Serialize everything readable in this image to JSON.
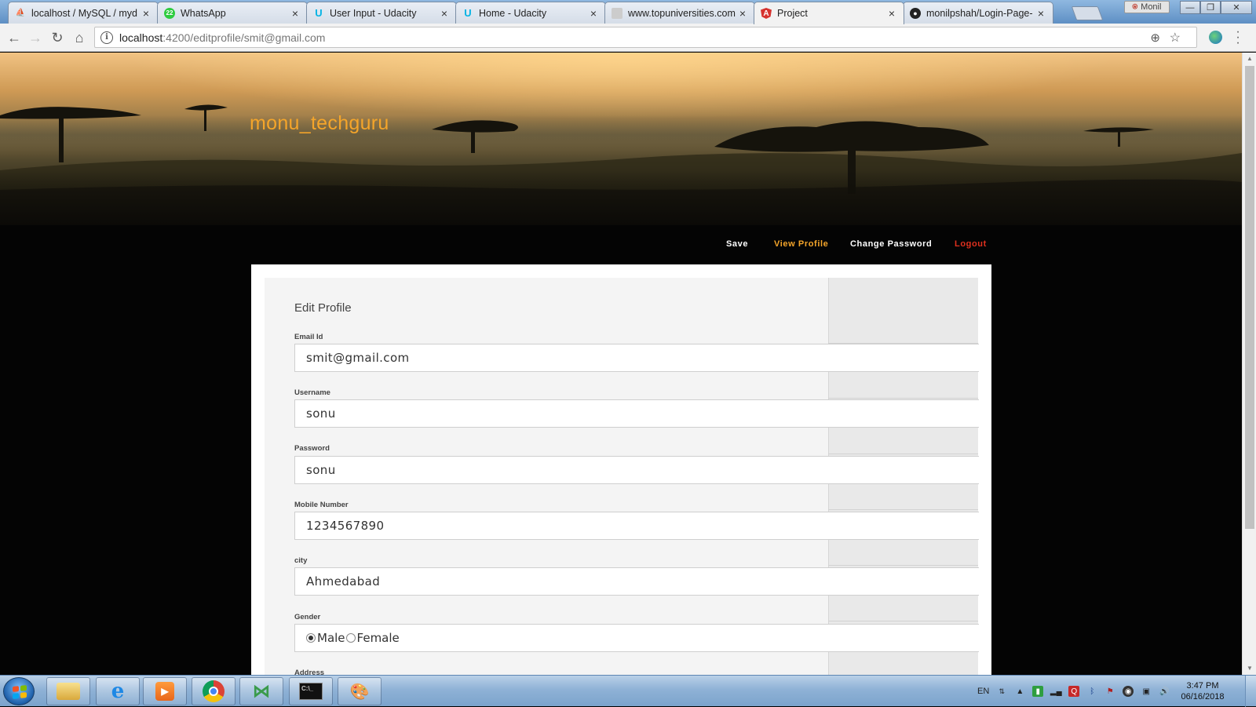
{
  "browser": {
    "tabs": [
      {
        "label": "localhost / MySQL / myd",
        "favicon": "phpmyadmin-icon"
      },
      {
        "label": "WhatsApp",
        "favicon": "whatsapp-icon",
        "badge": "22"
      },
      {
        "label": "User Input - Udacity",
        "favicon": "udacity-icon"
      },
      {
        "label": "Home - Udacity",
        "favicon": "udacity-icon"
      },
      {
        "label": "www.topuniversities.com",
        "favicon": "generic-page-icon"
      },
      {
        "label": "Project",
        "favicon": "angular-icon"
      },
      {
        "label": "monilpshah/Login-Page-",
        "favicon": "github-icon"
      }
    ],
    "active_tab_index": 5,
    "profile_name": "Monil",
    "address": {
      "host": "localhost",
      "path": ":4200/editprofile/smit@gmail.com"
    }
  },
  "site": {
    "title": "monu_techguru",
    "nav": {
      "save": "Save",
      "view_profile": "View Profile",
      "change_password": "Change Password",
      "logout": "Logout"
    }
  },
  "form": {
    "title": "Edit Profile",
    "fields": {
      "email": {
        "label": "Email Id",
        "value": "smit@gmail.com"
      },
      "username": {
        "label": "Username",
        "value": "sonu"
      },
      "password": {
        "label": "Password",
        "value": "sonu"
      },
      "mobile": {
        "label": "Mobile Number",
        "value": "1234567890"
      },
      "city": {
        "label": "city",
        "value": "Ahmedabad"
      },
      "gender": {
        "label": "Gender",
        "options": [
          "Male",
          "Female"
        ],
        "selected": "Male"
      },
      "address": {
        "label": "Address"
      }
    }
  },
  "taskbar": {
    "language": "EN",
    "time": "3:47 PM",
    "date": "06/16/2018"
  },
  "colors": {
    "accent_orange": "#f5a52a",
    "logout_red": "#e0301e",
    "nav_white": "#ffffff"
  }
}
